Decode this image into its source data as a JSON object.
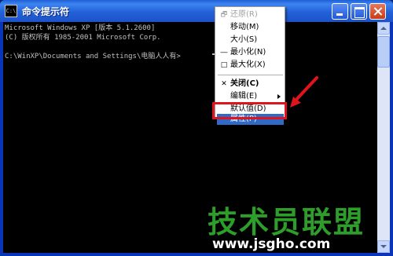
{
  "window": {
    "title": "命令提示符",
    "icon_text": "C:\\",
    "title_right": "电脑人人有",
    "buttons": [
      "minimize",
      "maximize",
      "close"
    ]
  },
  "console": {
    "lines": [
      "Microsoft Windows XP [版本 5.1.2600]",
      "(C) 版权所有 1985-2001 Microsoft Corp.",
      "",
      "C:\\WinXP\\Documents and Settings\\电脑人人有>"
    ]
  },
  "context_menu": {
    "items": [
      {
        "label": "还原(R)",
        "icon": "restore-icon",
        "disabled": true
      },
      {
        "label": "移动(M)"
      },
      {
        "label": "大小(S)"
      },
      {
        "label": "最小化(N)",
        "icon": "minimize-icon"
      },
      {
        "label": "最大化(X)",
        "icon": "maximize-icon"
      },
      {
        "label": "关闭(C)",
        "icon": "close-icon",
        "bold": true
      },
      {
        "label": "编辑(E)",
        "has_submenu": true
      },
      {
        "label": "默认值(D)"
      },
      {
        "label": "属性(P)",
        "selected": true
      }
    ]
  },
  "watermark": {
    "text": "技术员联盟",
    "url": "www.jsgho.com",
    "color": "#2e9e2a"
  },
  "colors": {
    "title_bar": "#2361d8",
    "console_bg": "#000000",
    "console_text": "#c0c0c0",
    "menu_highlight": "#316ac5",
    "annotation_red": "#e0141e"
  }
}
